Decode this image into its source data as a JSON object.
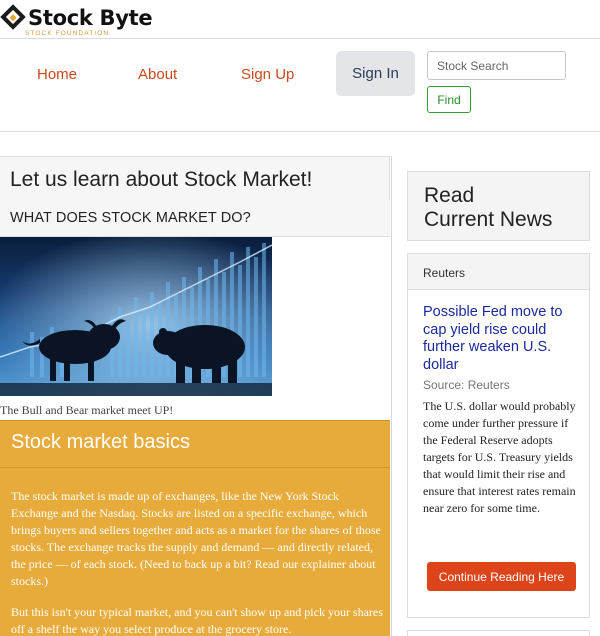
{
  "logo": {
    "name": "Stock Byte",
    "tagline": "STOCK FOUNDATION"
  },
  "nav": {
    "home": "Home",
    "about": "About",
    "signup": "Sign Up",
    "signin": "Sign In",
    "search_placeholder": "Stock Search",
    "find": "Find"
  },
  "main": {
    "title": "Let us learn about Stock Market!",
    "subtitle": "WHAT DOES STOCK MARKET DO?",
    "image_caption": "The Bull and Bear market meet UP!",
    "basics": {
      "title": "Stock market basics",
      "paragraphs": [
        "The stock market is made up of exchanges, like the New York Stock Exchange and the Nasdaq. Stocks are listed on a specific exchange, which brings buyers and sellers together and acts as a market for the shares of those stocks. The exchange tracks the supply and demand — and directly related, the price — of each stock. (Need to back up a bit? Read our explainer about stocks.)",
        "But this isn't your typical market, and you can't show up and pick your shares off a shelf the way you select produce at the grocery store."
      ]
    }
  },
  "news": {
    "heading_line1": "Read",
    "heading_line2": "Current News",
    "card": {
      "header": "Reuters",
      "title": "Possible Fed move to cap yield rise could further weaken U.S. dollar",
      "source": "Source: Reuters",
      "body": "The U.S. dollar would probably come under further pressure if the Federal Reserve adopts targets for U.S. Treasury yields that would limit their rise and ensure that interest rates remain near zero for some time.",
      "button": "Continue Reading Here"
    }
  },
  "colors": {
    "accent_orange": "#c9491c",
    "basics_bg": "#e6ab3a",
    "button_red": "#dd4419",
    "link_blue": "#1a2a9c"
  }
}
